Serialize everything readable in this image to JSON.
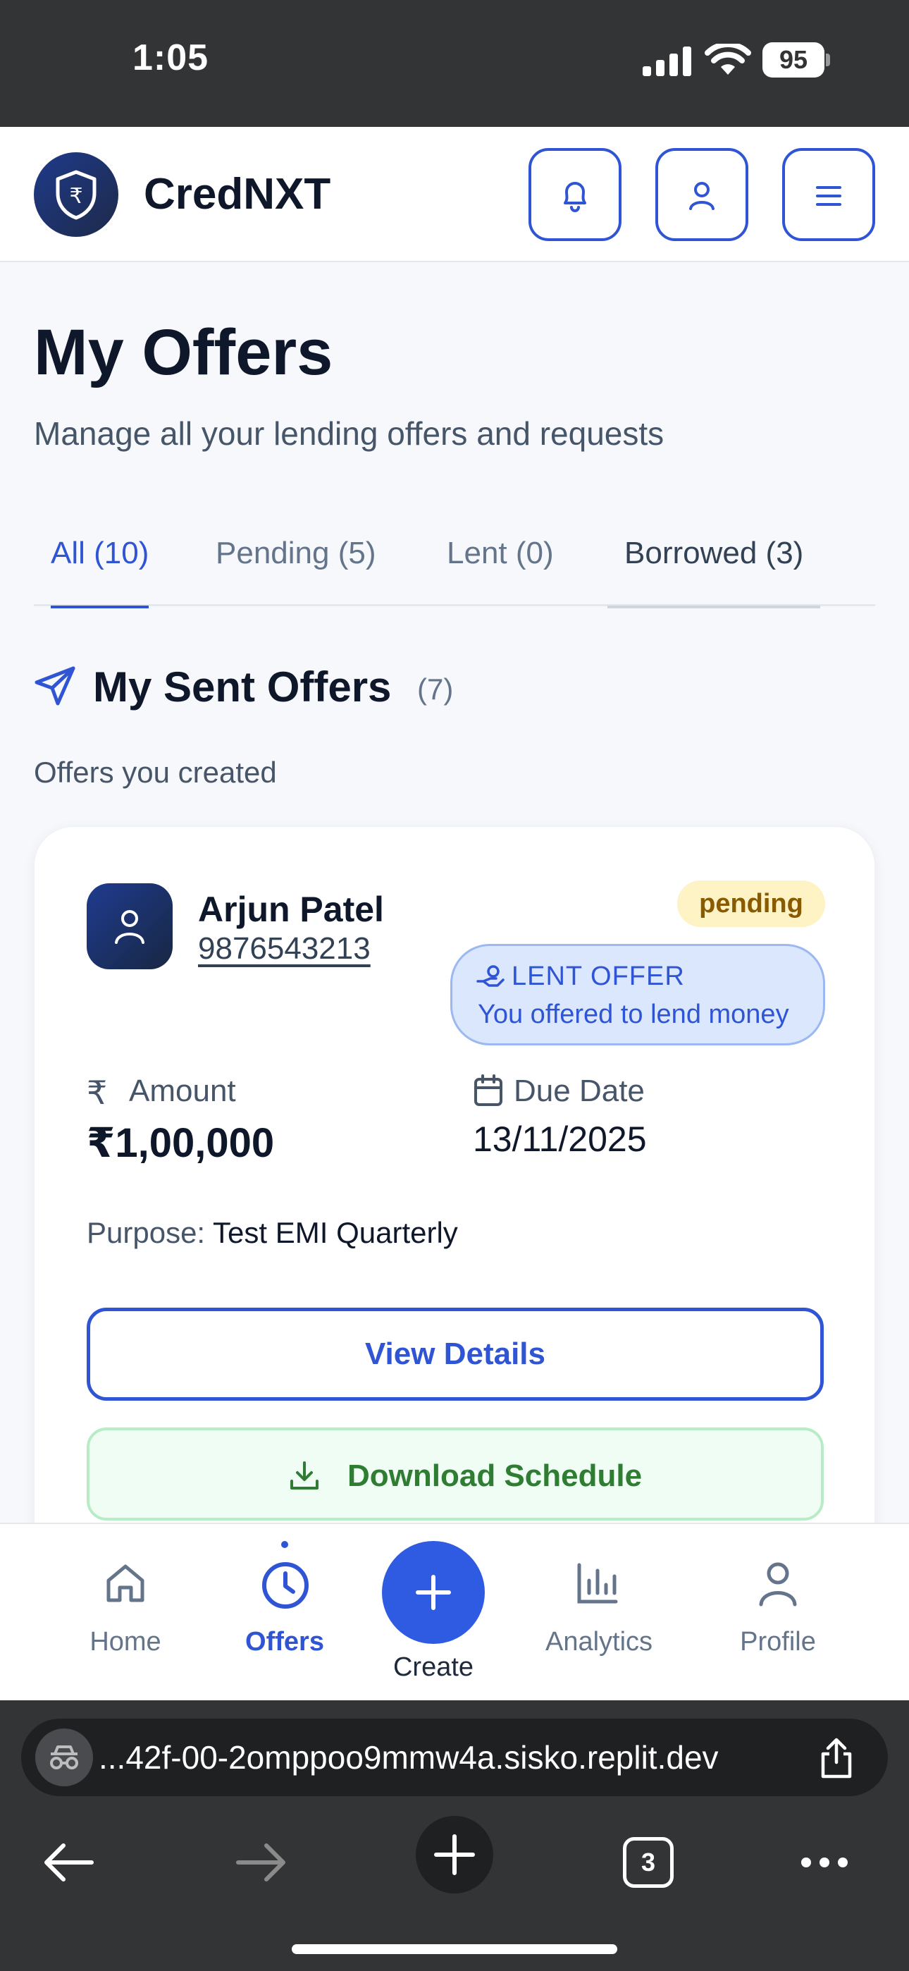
{
  "status_bar": {
    "time": "1:05",
    "battery": "95",
    "icons": [
      "cellular-signal-icon",
      "wifi-icon",
      "battery-icon"
    ]
  },
  "header": {
    "brand": "CredNXT",
    "logo_icon": "rupee-shield-icon",
    "buttons": [
      "bell-icon",
      "user-icon",
      "menu-icon"
    ]
  },
  "page": {
    "title": "My Offers",
    "subtitle": "Manage all your lending offers and requests"
  },
  "tabs": [
    {
      "label": "All (10)",
      "active": true
    },
    {
      "label": "Pending (5)",
      "active": false
    },
    {
      "label": "Lent (0)",
      "active": false
    },
    {
      "label": "Borrowed (3)",
      "active": false
    }
  ],
  "section": {
    "title": "My Sent Offers",
    "count": "(7)",
    "subtitle": "Offers you created"
  },
  "offer": {
    "name": "Arjun Patel",
    "phone": "9876543213",
    "status": "pending",
    "type_title": "LENT OFFER",
    "type_subtitle": "You offered to lend money",
    "amount_label": "Amount",
    "amount_value": "₹1,00,000",
    "due_label": "Due Date",
    "due_value": "13/11/2025",
    "purpose_label": "Purpose:",
    "purpose_value": "Test EMI Quarterly",
    "view_button": "View Details",
    "download_button": "Download Schedule"
  },
  "bottom_nav": [
    {
      "label": "Home",
      "icon": "home-icon",
      "active": false
    },
    {
      "label": "Offers",
      "icon": "clock-icon",
      "active": true
    },
    {
      "label": "Create",
      "icon": "plus-icon",
      "active": false
    },
    {
      "label": "Analytics",
      "icon": "bar-chart-icon",
      "active": false
    },
    {
      "label": "Profile",
      "icon": "user-icon",
      "active": false
    }
  ],
  "browser": {
    "url": "...42f-00-2omppoo9mmw4a.sisko.replit.dev",
    "tab_count": "3"
  },
  "colors": {
    "accent": "#2f55d4",
    "pending_bg": "#fdf3c4",
    "pending_text": "#8a5a00",
    "lent_bg": "#dbe7fd",
    "download_green": "#2e7d32"
  }
}
